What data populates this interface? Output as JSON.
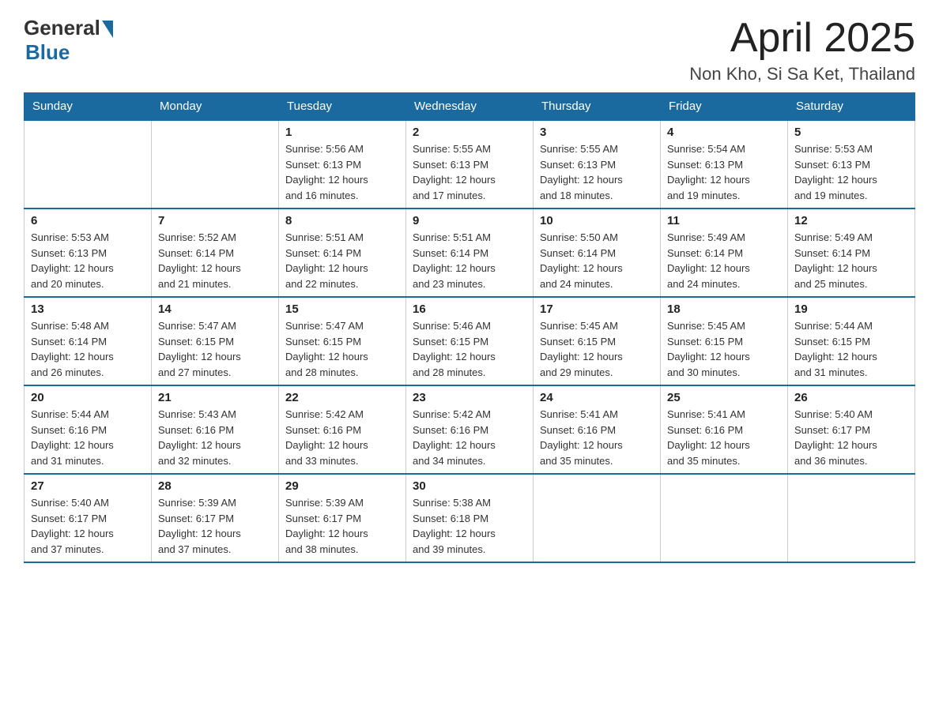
{
  "header": {
    "logo_general": "General",
    "logo_blue": "Blue",
    "month_title": "April 2025",
    "location": "Non Kho, Si Sa Ket, Thailand"
  },
  "weekdays": [
    "Sunday",
    "Monday",
    "Tuesday",
    "Wednesday",
    "Thursday",
    "Friday",
    "Saturday"
  ],
  "weeks": [
    [
      {
        "day": "",
        "info": ""
      },
      {
        "day": "",
        "info": ""
      },
      {
        "day": "1",
        "info": "Sunrise: 5:56 AM\nSunset: 6:13 PM\nDaylight: 12 hours\nand 16 minutes."
      },
      {
        "day": "2",
        "info": "Sunrise: 5:55 AM\nSunset: 6:13 PM\nDaylight: 12 hours\nand 17 minutes."
      },
      {
        "day": "3",
        "info": "Sunrise: 5:55 AM\nSunset: 6:13 PM\nDaylight: 12 hours\nand 18 minutes."
      },
      {
        "day": "4",
        "info": "Sunrise: 5:54 AM\nSunset: 6:13 PM\nDaylight: 12 hours\nand 19 minutes."
      },
      {
        "day": "5",
        "info": "Sunrise: 5:53 AM\nSunset: 6:13 PM\nDaylight: 12 hours\nand 19 minutes."
      }
    ],
    [
      {
        "day": "6",
        "info": "Sunrise: 5:53 AM\nSunset: 6:13 PM\nDaylight: 12 hours\nand 20 minutes."
      },
      {
        "day": "7",
        "info": "Sunrise: 5:52 AM\nSunset: 6:14 PM\nDaylight: 12 hours\nand 21 minutes."
      },
      {
        "day": "8",
        "info": "Sunrise: 5:51 AM\nSunset: 6:14 PM\nDaylight: 12 hours\nand 22 minutes."
      },
      {
        "day": "9",
        "info": "Sunrise: 5:51 AM\nSunset: 6:14 PM\nDaylight: 12 hours\nand 23 minutes."
      },
      {
        "day": "10",
        "info": "Sunrise: 5:50 AM\nSunset: 6:14 PM\nDaylight: 12 hours\nand 24 minutes."
      },
      {
        "day": "11",
        "info": "Sunrise: 5:49 AM\nSunset: 6:14 PM\nDaylight: 12 hours\nand 24 minutes."
      },
      {
        "day": "12",
        "info": "Sunrise: 5:49 AM\nSunset: 6:14 PM\nDaylight: 12 hours\nand 25 minutes."
      }
    ],
    [
      {
        "day": "13",
        "info": "Sunrise: 5:48 AM\nSunset: 6:14 PM\nDaylight: 12 hours\nand 26 minutes."
      },
      {
        "day": "14",
        "info": "Sunrise: 5:47 AM\nSunset: 6:15 PM\nDaylight: 12 hours\nand 27 minutes."
      },
      {
        "day": "15",
        "info": "Sunrise: 5:47 AM\nSunset: 6:15 PM\nDaylight: 12 hours\nand 28 minutes."
      },
      {
        "day": "16",
        "info": "Sunrise: 5:46 AM\nSunset: 6:15 PM\nDaylight: 12 hours\nand 28 minutes."
      },
      {
        "day": "17",
        "info": "Sunrise: 5:45 AM\nSunset: 6:15 PM\nDaylight: 12 hours\nand 29 minutes."
      },
      {
        "day": "18",
        "info": "Sunrise: 5:45 AM\nSunset: 6:15 PM\nDaylight: 12 hours\nand 30 minutes."
      },
      {
        "day": "19",
        "info": "Sunrise: 5:44 AM\nSunset: 6:15 PM\nDaylight: 12 hours\nand 31 minutes."
      }
    ],
    [
      {
        "day": "20",
        "info": "Sunrise: 5:44 AM\nSunset: 6:16 PM\nDaylight: 12 hours\nand 31 minutes."
      },
      {
        "day": "21",
        "info": "Sunrise: 5:43 AM\nSunset: 6:16 PM\nDaylight: 12 hours\nand 32 minutes."
      },
      {
        "day": "22",
        "info": "Sunrise: 5:42 AM\nSunset: 6:16 PM\nDaylight: 12 hours\nand 33 minutes."
      },
      {
        "day": "23",
        "info": "Sunrise: 5:42 AM\nSunset: 6:16 PM\nDaylight: 12 hours\nand 34 minutes."
      },
      {
        "day": "24",
        "info": "Sunrise: 5:41 AM\nSunset: 6:16 PM\nDaylight: 12 hours\nand 35 minutes."
      },
      {
        "day": "25",
        "info": "Sunrise: 5:41 AM\nSunset: 6:16 PM\nDaylight: 12 hours\nand 35 minutes."
      },
      {
        "day": "26",
        "info": "Sunrise: 5:40 AM\nSunset: 6:17 PM\nDaylight: 12 hours\nand 36 minutes."
      }
    ],
    [
      {
        "day": "27",
        "info": "Sunrise: 5:40 AM\nSunset: 6:17 PM\nDaylight: 12 hours\nand 37 minutes."
      },
      {
        "day": "28",
        "info": "Sunrise: 5:39 AM\nSunset: 6:17 PM\nDaylight: 12 hours\nand 37 minutes."
      },
      {
        "day": "29",
        "info": "Sunrise: 5:39 AM\nSunset: 6:17 PM\nDaylight: 12 hours\nand 38 minutes."
      },
      {
        "day": "30",
        "info": "Sunrise: 5:38 AM\nSunset: 6:18 PM\nDaylight: 12 hours\nand 39 minutes."
      },
      {
        "day": "",
        "info": ""
      },
      {
        "day": "",
        "info": ""
      },
      {
        "day": "",
        "info": ""
      }
    ]
  ]
}
